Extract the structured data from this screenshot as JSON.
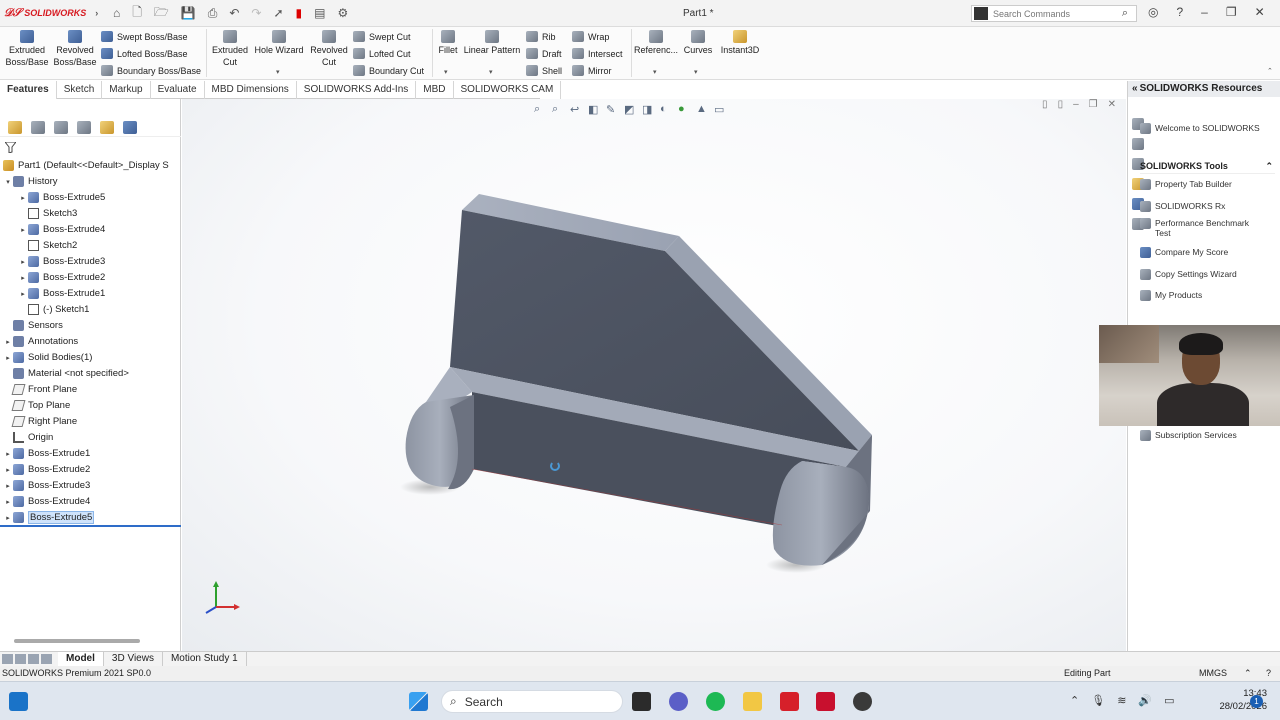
{
  "app": {
    "logo_text": "SOLIDWORKS",
    "document_title": "Part1 *",
    "search_placeholder": "Search Commands"
  },
  "ribbon": {
    "big": [
      {
        "id": "extruded-boss",
        "label": "Extruded Boss/Base"
      },
      {
        "id": "revolved-boss",
        "label": "Revolved Boss/Base"
      },
      {
        "id": "extruded-cut",
        "label": "Extruded Cut"
      },
      {
        "id": "hole-wizard",
        "label": "Hole Wizard"
      },
      {
        "id": "revolved-cut",
        "label": "Revolved Cut"
      },
      {
        "id": "fillet",
        "label": "Fillet"
      },
      {
        "id": "linear-pattern",
        "label": "Linear Pattern"
      },
      {
        "id": "reference",
        "label": "Referenc..."
      },
      {
        "id": "curves",
        "label": "Curves"
      },
      {
        "id": "instant3d",
        "label": "Instant3D"
      }
    ],
    "small": {
      "swept_boss": "Swept Boss/Base",
      "lofted_boss": "Lofted Boss/Base",
      "boundary_boss": "Boundary Boss/Base",
      "swept_cut": "Swept Cut",
      "lofted_cut": "Lofted Cut",
      "boundary_cut": "Boundary Cut",
      "rib": "Rib",
      "draft": "Draft",
      "shell": "Shell",
      "wrap": "Wrap",
      "intersect": "Intersect",
      "mirror": "Mirror"
    }
  },
  "tabs": [
    "Features",
    "Sketch",
    "Markup",
    "Evaluate",
    "MBD Dimensions",
    "SOLIDWORKS Add-Ins",
    "MBD",
    "SOLIDWORKS CAM"
  ],
  "tree": {
    "root": "Part1  (Default<<Default>_Display S",
    "history": "History",
    "history_items": [
      "Boss-Extrude5",
      "Sketch3",
      "Boss-Extrude4",
      "Sketch2",
      "Boss-Extrude3",
      "Boss-Extrude2",
      "Boss-Extrude1",
      "(-) Sketch1"
    ],
    "sensors": "Sensors",
    "annotations": "Annotations",
    "solid_bodies": "Solid Bodies(1)",
    "material": "Material <not specified>",
    "front_plane": "Front Plane",
    "top_plane": "Top Plane",
    "right_plane": "Right Plane",
    "origin": "Origin",
    "features": [
      "Boss-Extrude1",
      "Boss-Extrude2",
      "Boss-Extrude3",
      "Boss-Extrude4",
      "Boss-Extrude5"
    ]
  },
  "right_panel": {
    "title": "SOLIDWORKS Resources",
    "welcome": "Welcome to SOLIDWORKS",
    "tools_header": "SOLIDWORKS Tools",
    "tools": [
      "Property Tab Builder",
      "SOLIDWORKS Rx",
      "Performance Benchmark Test",
      "Compare My Score",
      "Copy Settings Wizard",
      "My Products"
    ],
    "subscription": "Subscription Services"
  },
  "bottom_tabs": [
    "Model",
    "3D Views",
    "Motion Study 1"
  ],
  "status": {
    "product": "SOLIDWORKS Premium 2021 SP0.0",
    "mode": "Editing Part",
    "units": "MMGS"
  },
  "taskbar": {
    "search": "Search",
    "time": "13:43",
    "date": "28/02/2026",
    "badge": "1"
  },
  "colors": {
    "accent": "#2e6cc8",
    "logo": "#d71920",
    "model_dark": "#4f5663",
    "model_light": "#a8afbd"
  }
}
